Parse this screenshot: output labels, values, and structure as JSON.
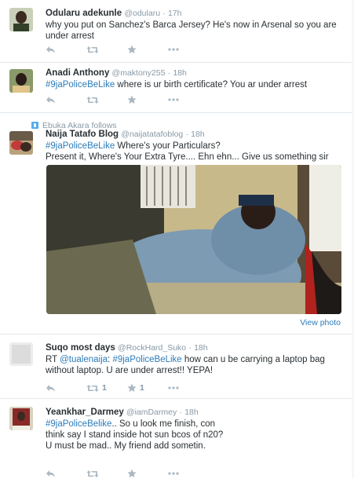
{
  "tweets": [
    {
      "name": "Odularu adekunle",
      "handle": "@odularu",
      "time": "17h",
      "text_before": "why you put on Sanchez's Barca Jersey? He's now in Arsenal so you are under arrest",
      "hashtag": ""
    },
    {
      "name": "Anadi Anthony",
      "handle": "@maktony255",
      "time": "18h",
      "hashtag": "#9jaPoliceBeLike",
      "text_after": " where is ur birth certificate? You ar under arrest"
    },
    {
      "context": "Ebuka Akara follows",
      "name": "Naija Tatafo Blog",
      "handle": "@naijatatafoblog",
      "time": "18h",
      "hashtag": "#9jaPoliceBeLike",
      "text_after": "  Where's your Particulars?",
      "line2": "Present it, Where's Your Extra Tyre.... Ehn ehn... Give us something sir",
      "view_photo": "View photo"
    },
    {
      "name": "Suqo most days",
      "handle": "@RockHard_Suko",
      "time": "18h",
      "rt": "RT",
      "mention": "@tualenaija",
      "colon": ":",
      "hashtag": "#9jaPoliceBeLike",
      "text_after": " how can u be carrying a laptop bag without laptop. U are under arrest!! YEPA!",
      "retweet_count": "1",
      "favorite_count": "1"
    },
    {
      "name": "Yeankhar_Darmey",
      "handle": "@iamDarmey",
      "time": "18h",
      "hashtag": "#9jaPoliceBelike",
      "text_after": ".. So u look me finish, con think say I stand inside hot sun bcos of n20? U must be mad.. My friend add sometin."
    }
  ],
  "separator": "·",
  "colors": {
    "link": "#2b7bb9",
    "muted": "#8899a6",
    "icon": "#aab8c2"
  },
  "icons": [
    "reply-icon",
    "retweet-icon",
    "favorite-icon",
    "more-icon",
    "follows-icon"
  ]
}
